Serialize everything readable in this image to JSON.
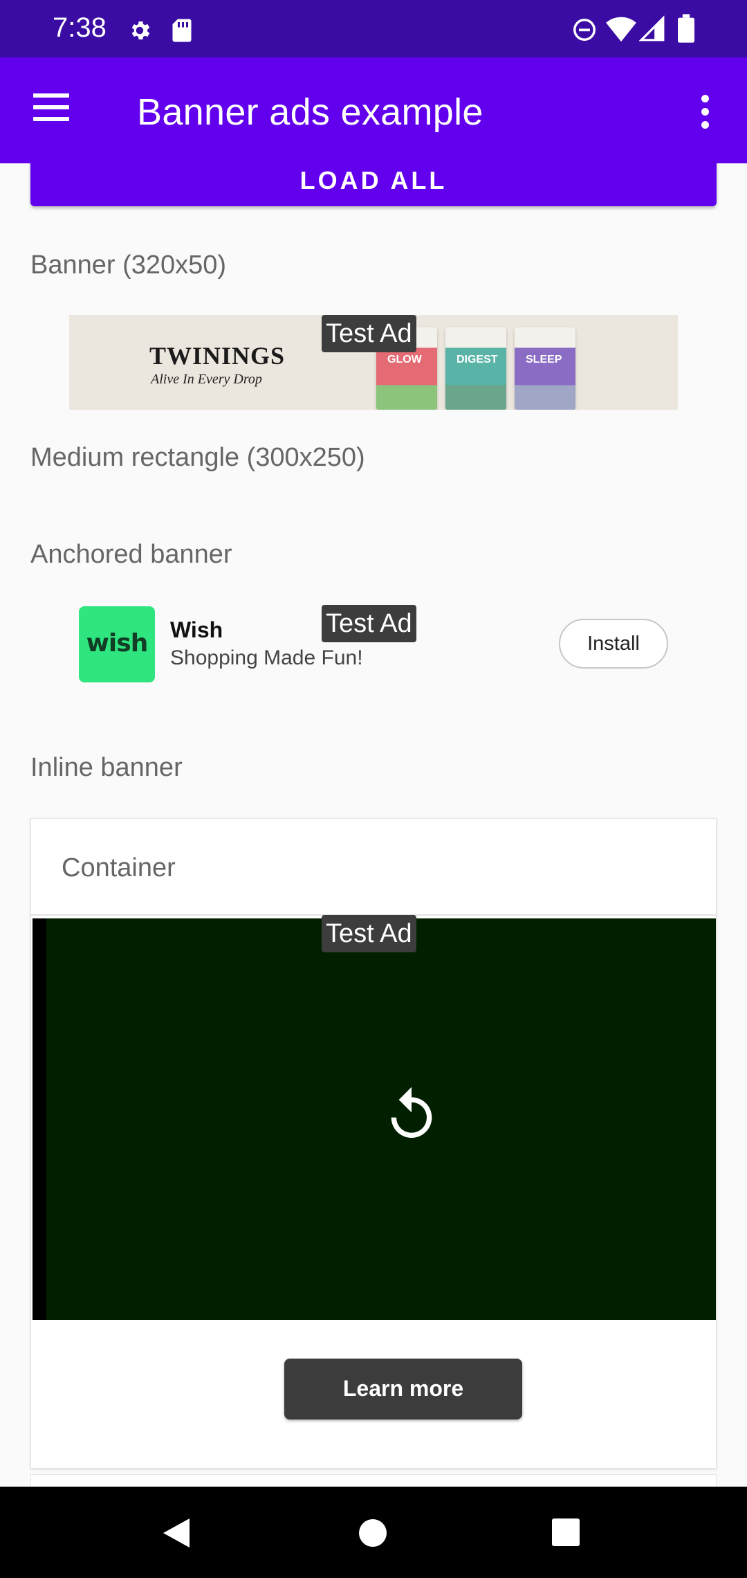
{
  "status_bar": {
    "time": "7:38",
    "icons": [
      "gear-icon",
      "sd-card-icon",
      "do-not-disturb-icon",
      "wifi-icon",
      "signal-icon",
      "battery-icon"
    ]
  },
  "app_bar": {
    "title": "Banner ads example",
    "menu_icon": "menu-icon",
    "overflow_icon": "more-vert-icon"
  },
  "load_all_button": "LOAD ALL",
  "sections": {
    "banner": "Banner (320x50)",
    "medium_rectangle": "Medium rectangle (300x250)",
    "anchored": "Anchored banner",
    "inline": "Inline banner"
  },
  "test_ad_label": "Test Ad",
  "banner_ad": {
    "brand": "TWININGS",
    "tagline": "Alive In Every Drop",
    "boxes": [
      "GLOW",
      "DIGEST",
      "SLEEP"
    ]
  },
  "anchored_ad": {
    "logo_text": "wish",
    "title": "Wish",
    "subtitle": "Shopping Made Fun!",
    "install": "Install"
  },
  "inline_card": {
    "header": "Container",
    "replay_icon": "replay-icon",
    "learn_more": "Learn more"
  },
  "colors": {
    "status_bar": "#3a0ca3",
    "app_bar": "#6200ee",
    "video_bg": "#002000",
    "wish_green": "#2fe57f"
  }
}
